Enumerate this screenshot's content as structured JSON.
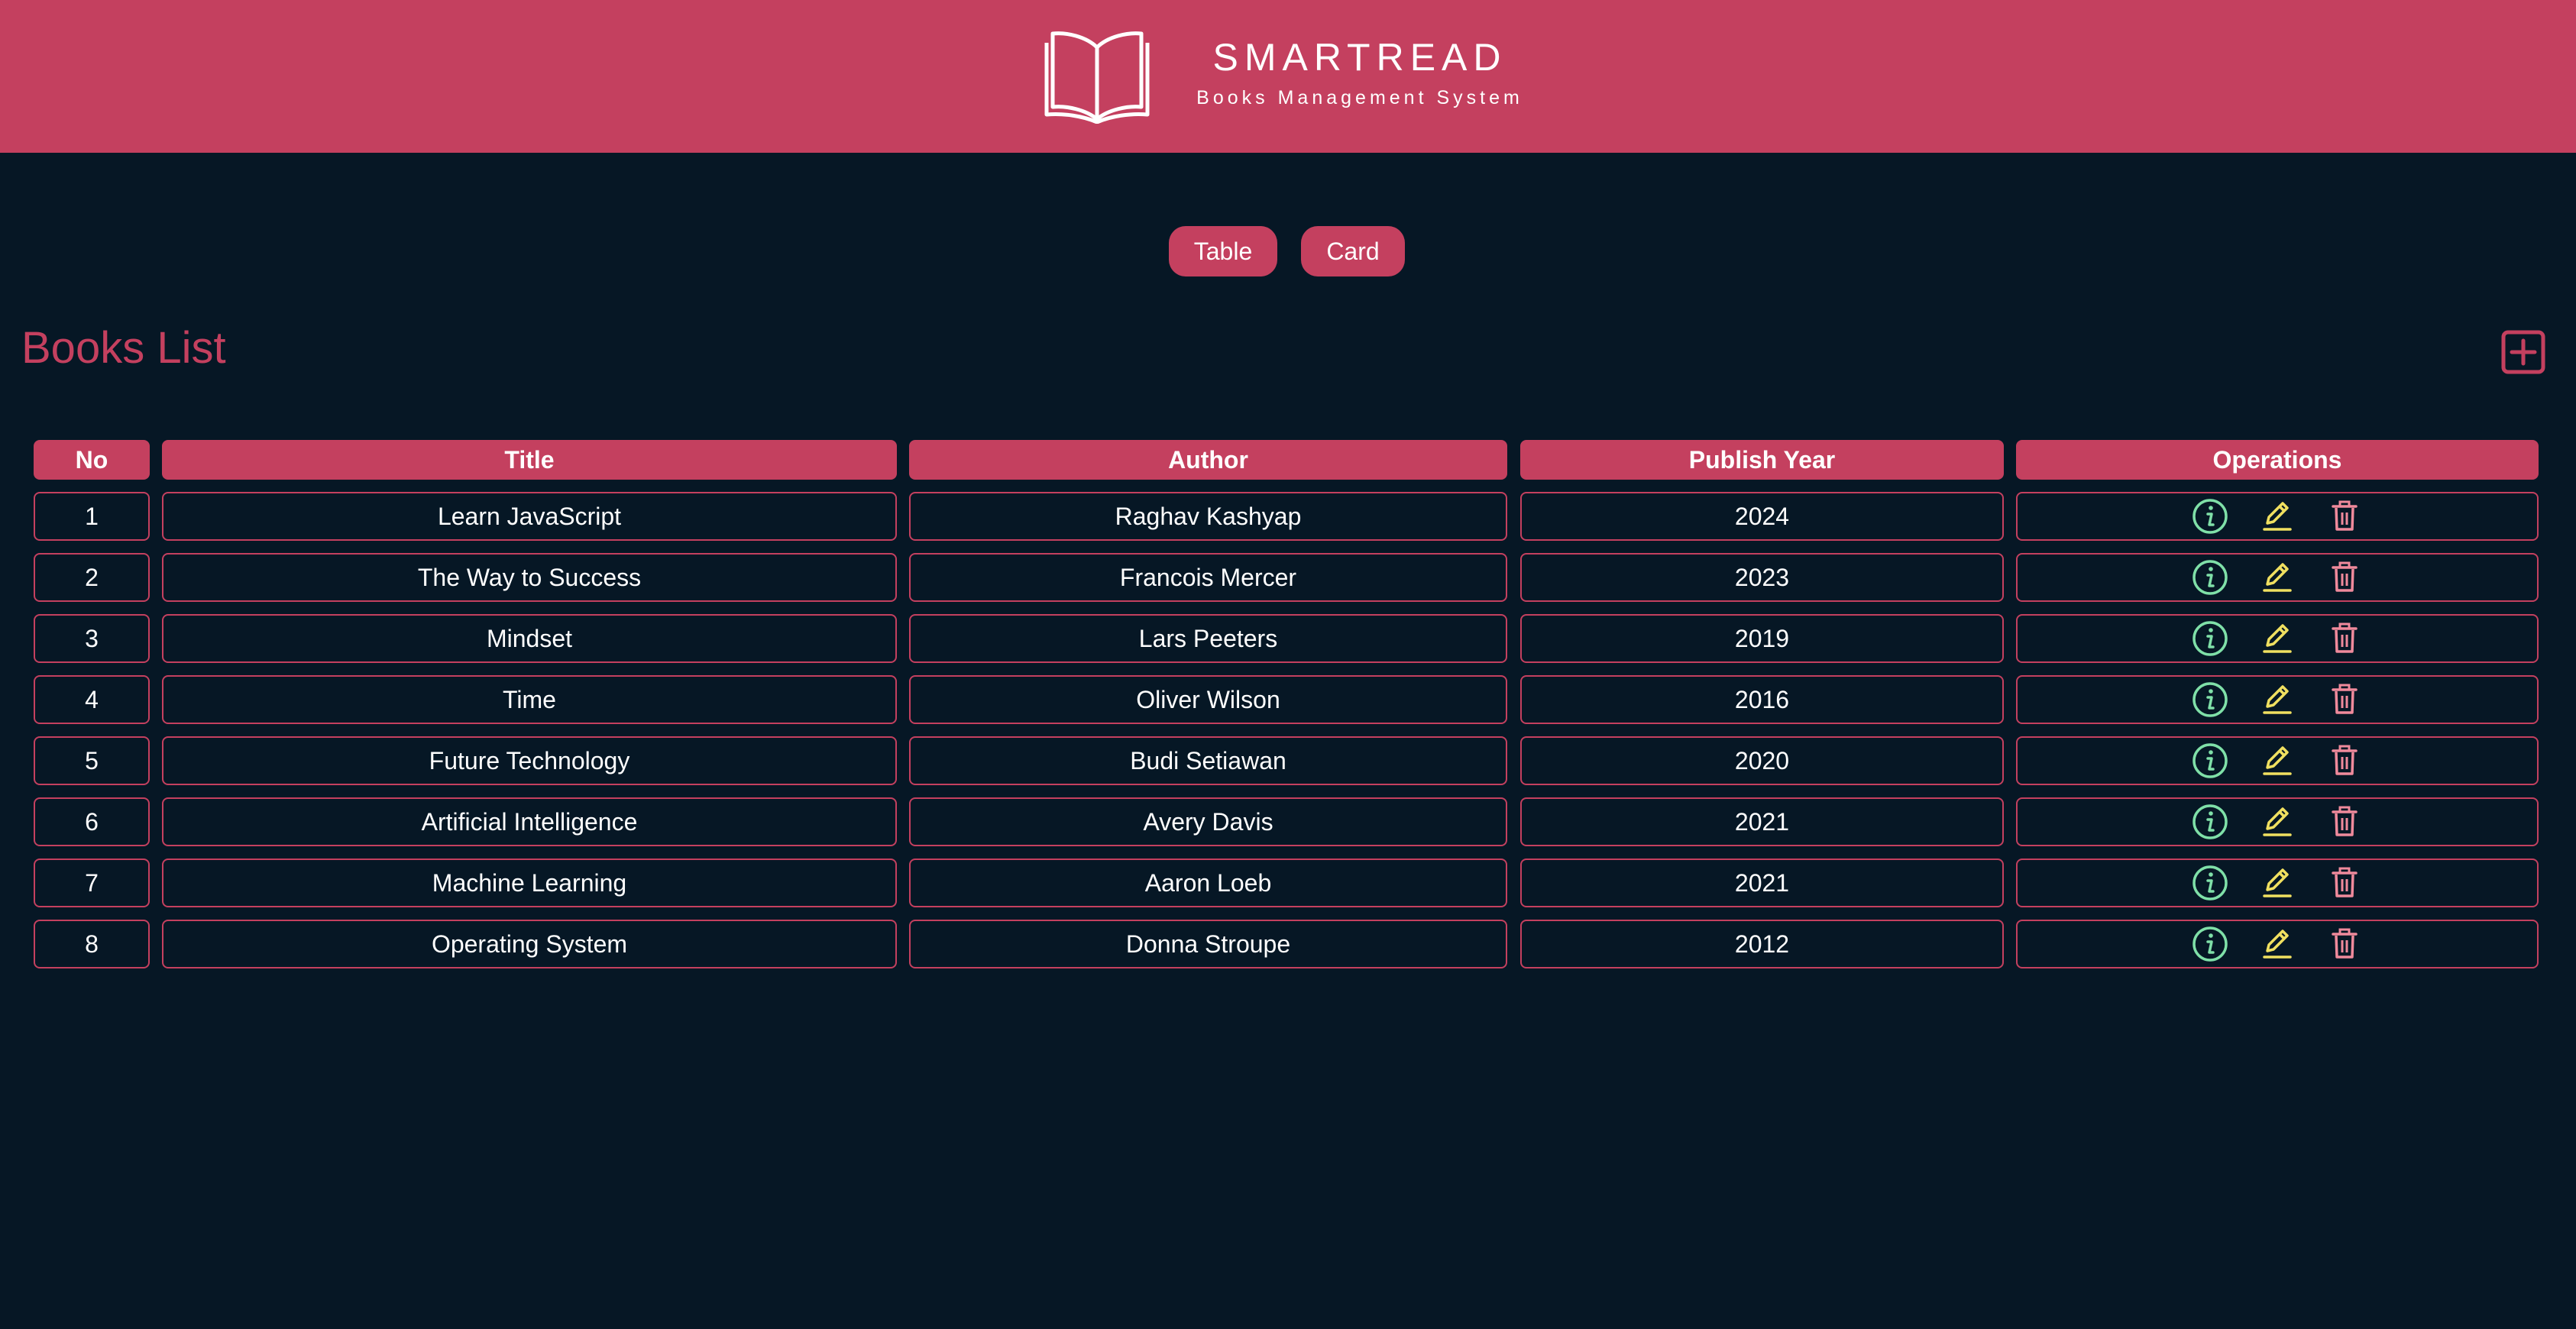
{
  "header": {
    "brand_name": "SMARTREAD",
    "tagline": "Books Management System",
    "logo_icon": "open-book-icon"
  },
  "view_toggle": {
    "table_label": "Table",
    "card_label": "Card"
  },
  "main": {
    "title": "Books List",
    "add_icon": "plus-square-icon"
  },
  "table": {
    "columns": [
      "No",
      "Title",
      "Author",
      "Publish Year",
      "Operations"
    ],
    "rows": [
      {
        "no": "1",
        "title": "Learn JavaScript",
        "author": "Raghav Kashyap",
        "year": "2024"
      },
      {
        "no": "2",
        "title": "The Way to Success",
        "author": "Francois Mercer",
        "year": "2023"
      },
      {
        "no": "3",
        "title": "Mindset",
        "author": "Lars Peeters",
        "year": "2019"
      },
      {
        "no": "4",
        "title": "Time",
        "author": "Oliver Wilson",
        "year": "2016"
      },
      {
        "no": "5",
        "title": "Future Technology",
        "author": "Budi Setiawan",
        "year": "2020"
      },
      {
        "no": "6",
        "title": "Artificial Intelligence",
        "author": "Avery Davis",
        "year": "2021"
      },
      {
        "no": "7",
        "title": "Machine Learning",
        "author": "Aaron Loeb",
        "year": "2021"
      },
      {
        "no": "8",
        "title": "Operating System",
        "author": "Donna Stroupe",
        "year": "2012"
      }
    ],
    "operation_icons": [
      "info-icon",
      "edit-icon",
      "delete-icon"
    ]
  },
  "colors": {
    "background": "#061725",
    "accent": "#c4405f",
    "info": "#7fe0a8",
    "edit": "#f0e060",
    "delete": "#f08a9c"
  }
}
